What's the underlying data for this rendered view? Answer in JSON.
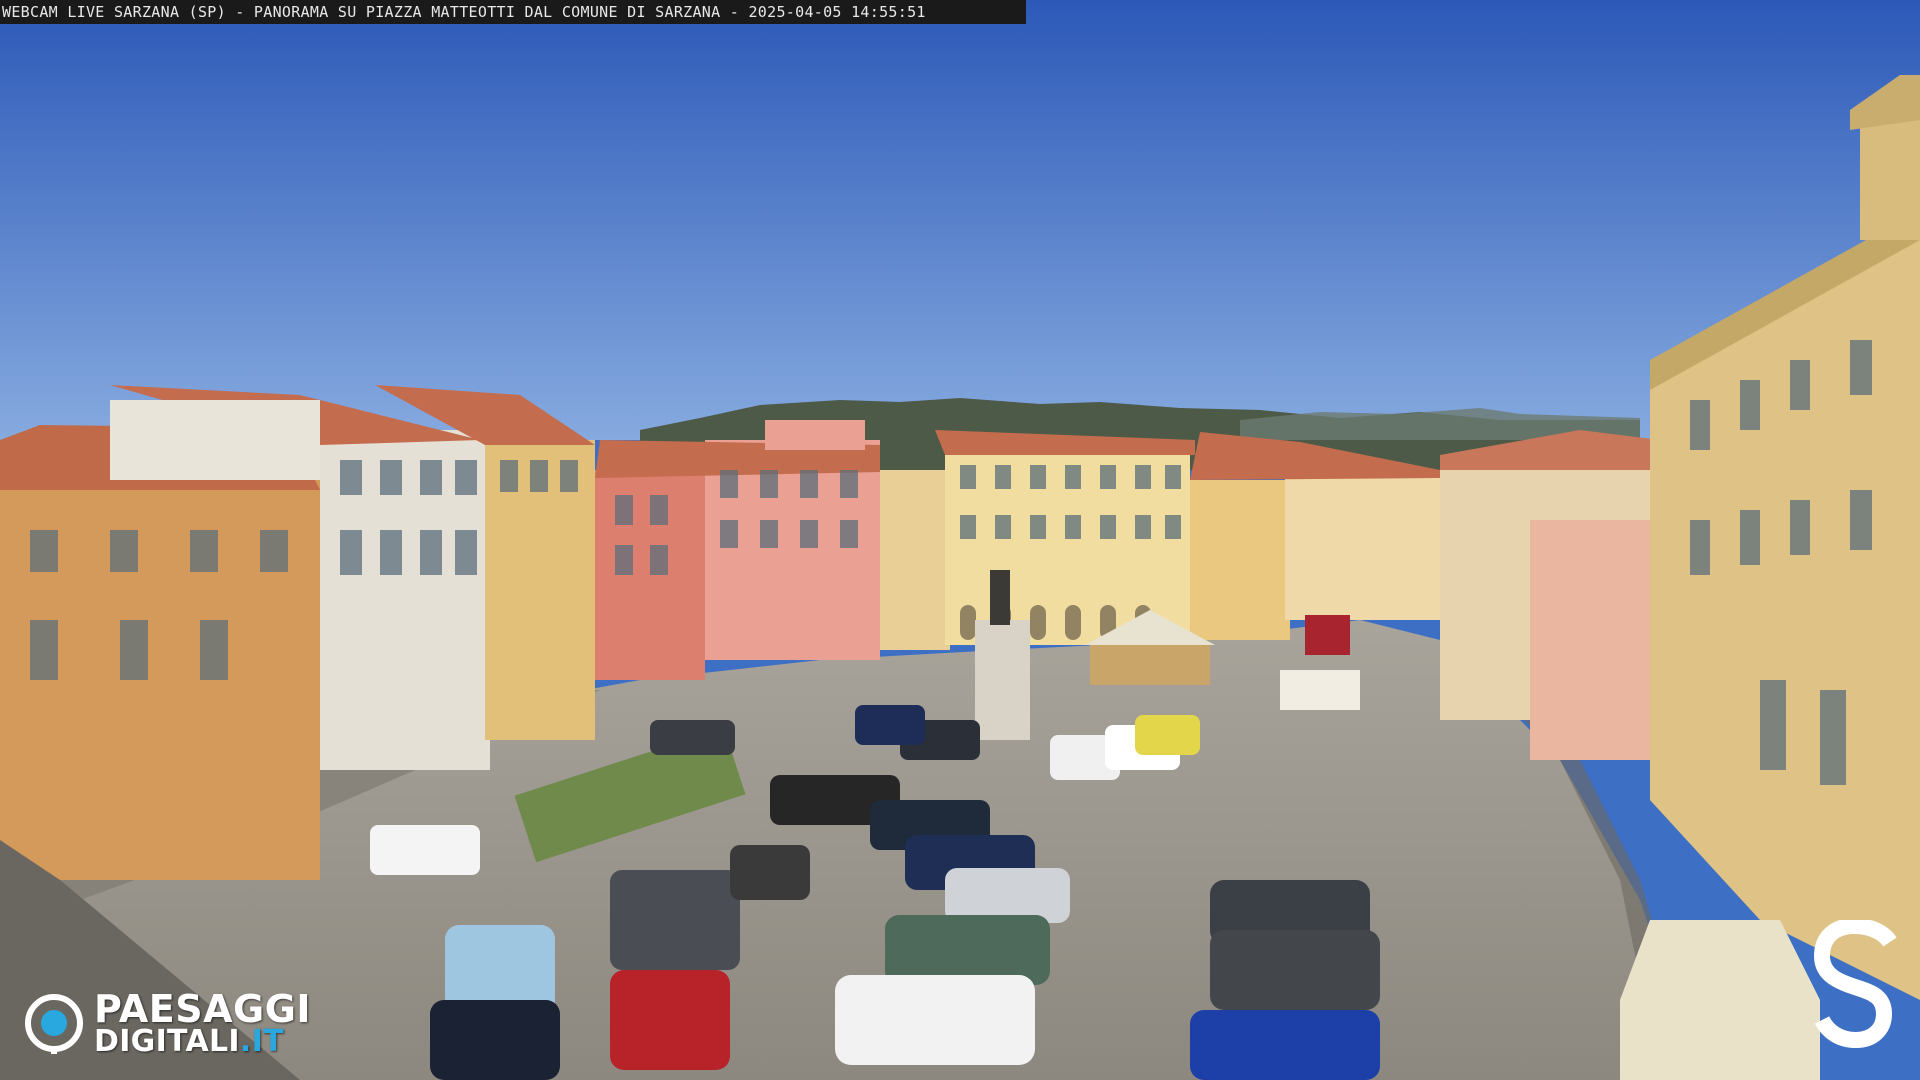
{
  "overlay": {
    "caption": "WEBCAM LIVE SARZANA (SP) - PANORAMA SU PIAZZA MATTEOTTI DAL COMUNE DI SARZANA - 2025-04-05  14:55:51"
  },
  "logo": {
    "line1": "PAESAGGI",
    "line2_main": "DIGITALI",
    "line2_accent": ".IT",
    "icon": "eye-icon",
    "accent_color": "#29a8e0"
  },
  "watermark": {
    "icon": "s-letter-logo"
  },
  "colors": {
    "sky_top": "#2f5fbf",
    "sky_bottom": "#7fa6df",
    "pavement": "#9a958c",
    "terracotta": "#c86a4a",
    "ochre": "#d8a75a",
    "pink": "#e49a8c"
  }
}
